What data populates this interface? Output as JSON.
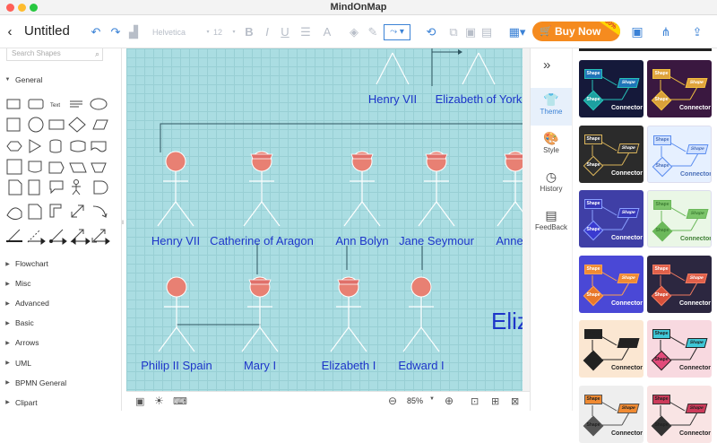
{
  "window": {
    "title": "MindOnMap"
  },
  "toolbar": {
    "doc_title": "Untitled",
    "font_family": "Helvetica",
    "font_size": "12",
    "buy_now_label": "Buy Now",
    "discount_badge": "-60%"
  },
  "left_panel": {
    "search_placeholder": "Search Shapes",
    "general_label": "General",
    "text_shape_label": "Text",
    "categories": [
      "Flowchart",
      "Misc",
      "Advanced",
      "Basic",
      "Arrows",
      "UML",
      "BPMN General",
      "Clipart"
    ]
  },
  "canvas": {
    "people": [
      {
        "name": "Henry VII",
        "hat": false
      },
      {
        "name": "Elizabeth of York",
        "hat": false
      },
      {
        "name": "Henry VII",
        "hat": false
      },
      {
        "name": "Catherine of Aragon",
        "hat": true
      },
      {
        "name": "Ann Bolyn",
        "hat": true
      },
      {
        "name": "Jane Seymour",
        "hat": true
      },
      {
        "name": "Anne C",
        "hat": true
      },
      {
        "name": "Philip II Spain",
        "hat": false
      },
      {
        "name": "Mary I",
        "hat": true
      },
      {
        "name": "Elizabeth I",
        "hat": true
      },
      {
        "name": "Edward I",
        "hat": false
      }
    ],
    "big_text": "Eliz"
  },
  "bottom_bar": {
    "zoom": "85%"
  },
  "right_panel": {
    "tabs": [
      {
        "label": "Theme",
        "icon": "shirt-icon",
        "active": true
      },
      {
        "label": "Style",
        "icon": "palette-icon",
        "active": false
      },
      {
        "label": "History",
        "icon": "clock-icon",
        "active": false
      },
      {
        "label": "FeedBack",
        "icon": "chat-icon",
        "active": false
      }
    ],
    "theme_shape_label": "Shape",
    "theme_connector_label": "Connector",
    "themes": [
      {
        "bg": "#15193a",
        "box": "#1e74b8",
        "dia": "#1da0a0",
        "line": "#27c1b8",
        "txt": "#ffffff"
      },
      {
        "bg": "#3a1840",
        "box": "#e0a33c",
        "dia": "#d9a03a",
        "line": "#f0c040",
        "txt": "#ffffff"
      },
      {
        "bg": "#2b2b2b",
        "box": "#333333",
        "dia": "#2f2f2f",
        "line": "#d9b35a",
        "txt": "#ffffff"
      },
      {
        "bg": "#e6f0ff",
        "box": "#cfe0ff",
        "dia": "#dbe7ff",
        "line": "#5b8def",
        "txt": "#4a6fb8"
      },
      {
        "bg": "#3f3fa6",
        "box": "#3737b8",
        "dia": "#3a3ad0",
        "line": "#8aa0ff",
        "txt": "#ffffff"
      },
      {
        "bg": "#eaf7e6",
        "box": "#7cc46a",
        "dia": "#6bb85a",
        "line": "#6bb85a",
        "txt": "#3f7f35"
      },
      {
        "bg": "#4a48d6",
        "box": "#f08a32",
        "dia": "#e8782a",
        "line": "#ffa050",
        "txt": "#ffffff"
      },
      {
        "bg": "#2c2740",
        "box": "#e0604a",
        "dia": "#d8503a",
        "line": "#f07a60",
        "txt": "#ffffff"
      },
      {
        "bg": "#fbe7d2",
        "box": "#222222",
        "dia": "#222222",
        "line": "#222222",
        "txt": "#222222"
      },
      {
        "bg": "#f8d9e0",
        "box": "#3fc7d6",
        "dia": "#e24a7a",
        "line": "#222222",
        "txt": "#222222"
      },
      {
        "bg": "#eeeeee",
        "box": "#f08a32",
        "dia": "#555555",
        "line": "#555555",
        "txt": "#222222"
      },
      {
        "bg": "#f9e4e4",
        "box": "#cc3b5a",
        "dia": "#333333",
        "line": "#333333",
        "txt": "#222222"
      }
    ]
  }
}
